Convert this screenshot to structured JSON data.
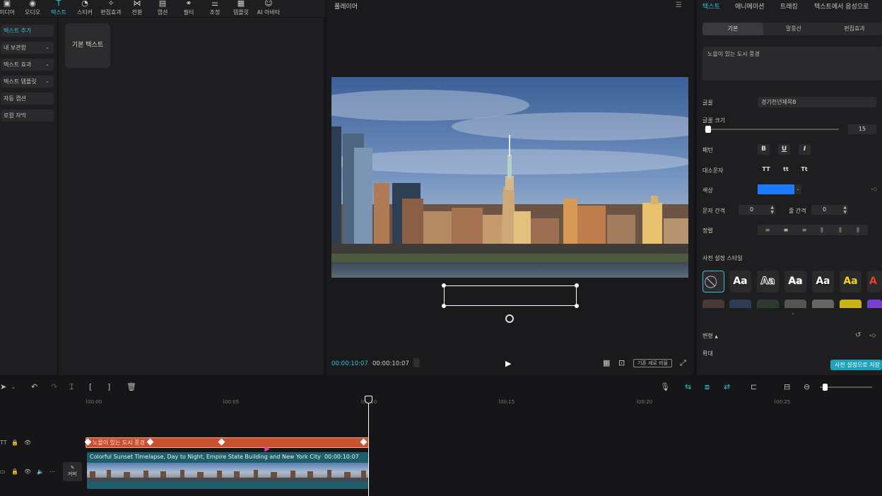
{
  "toolbar": {
    "items": [
      {
        "label": "미디어",
        "icon": "media-icon"
      },
      {
        "label": "오디오",
        "icon": "audio-icon"
      },
      {
        "label": "텍스트",
        "icon": "text-icon",
        "active": true
      },
      {
        "label": "스티커",
        "icon": "sticker-icon"
      },
      {
        "label": "편집효과",
        "icon": "effects-icon"
      },
      {
        "label": "전환",
        "icon": "transition-icon"
      },
      {
        "label": "캡션",
        "icon": "caption-icon"
      },
      {
        "label": "필터",
        "icon": "filter-icon"
      },
      {
        "label": "조정",
        "icon": "adjust-icon"
      },
      {
        "label": "템플릿",
        "icon": "template-icon"
      },
      {
        "label": "AI 아바타",
        "icon": "ai-avatar-icon"
      }
    ]
  },
  "leftnav": {
    "items": [
      {
        "label": "텍스트 추가",
        "active": true
      },
      {
        "label": "내 보관함",
        "chevron": true
      },
      {
        "label": "텍스트 효과",
        "chevron": true
      },
      {
        "label": "텍스트 템플릿",
        "chevron": true
      },
      {
        "label": "자동 캡션"
      },
      {
        "label": "로컬 자막"
      }
    ]
  },
  "library": {
    "basic_text": "기본 텍스트"
  },
  "player": {
    "title": "플레이어",
    "current_time": "00:00:10:07",
    "total_time": "00:00:10:07",
    "ratio_label": "기존 세로 비율"
  },
  "rightpanel": {
    "tabs": [
      "텍스트",
      "애니메이션",
      "트래킹",
      "텍스트에서 음성으로"
    ],
    "subtabs": [
      "기본",
      "말풍선",
      "편집효과"
    ],
    "text_content": "노을이 있는 도시 풍경",
    "labels": {
      "font": "글꼴",
      "font_size": "글꼴 크기",
      "pattern": "패턴",
      "case": "대소문자",
      "color": "색상",
      "char_spacing": "문자 간격",
      "line_spacing": "줄 간격",
      "align": "정렬",
      "preset_style": "사전 설정 스타일",
      "transform": "변형",
      "scale": "확대"
    },
    "font_value": "경기천년제목B",
    "font_size_value": "15",
    "format_buttons": [
      "B",
      "U",
      "I"
    ],
    "case_buttons": [
      "TT",
      "tt",
      "Tt"
    ],
    "color_value": "#1b7bff",
    "char_spacing_value": "0",
    "line_spacing_value": "0",
    "preset_samples": [
      "Aa",
      "Aa",
      "Aa",
      "Aa",
      "Aa",
      "A"
    ],
    "save_preset": "사전 설정으로 저장"
  },
  "timeline": {
    "ticks": [
      "00:00",
      "00:05",
      "00:10",
      "00:15",
      "00:20",
      "00:25"
    ],
    "text_clip": "노을이 있는 도시 풍경",
    "video_clip_title": "Colorful Sunset Timelapse, Day to Night, Empire State Building and New York City",
    "video_clip_duration": "00:00:10:07",
    "cover_label": "커버"
  },
  "colors": {
    "accent": "#2ec4d6",
    "text_clip": "#c8522f",
    "video_clip": "#1d5e6a"
  }
}
